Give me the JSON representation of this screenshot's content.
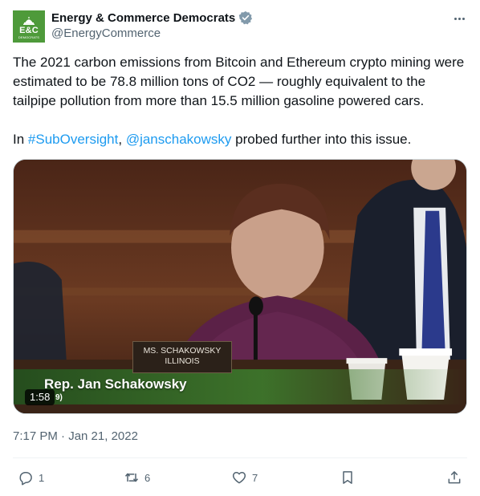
{
  "account": {
    "display_name": "Energy & Commerce Democrats",
    "handle": "@EnergyCommerce",
    "avatar_abbr": "E&C",
    "avatar_sub": "DEMOCRATS",
    "verified_color": "#829aab",
    "avatar_color": "#4e9a3a"
  },
  "post": {
    "line1": "The 2021 carbon emissions from Bitcoin and Ethereum crypto mining were estimated to be 78.8 million tons of CO2 — roughly equivalent to the tailpipe pollution from more than 15.5 million gasoline powered cars.",
    "p2_pre": "In ",
    "hashtag": "#SubOversight",
    "p2_mid": ", ",
    "mention": "@janschakowsky",
    "p2_post": " probed further into this issue.",
    "timestamp": "7:17 PM · Jan 21, 2022"
  },
  "video": {
    "duration": "1:58",
    "caption_name": "Rep. Jan Schakowsky",
    "caption_sub": "9)",
    "nameplate_line1": "MS. SCHAKOWSKY",
    "nameplate_line2": "ILLINOIS"
  },
  "actions": {
    "replies": "1",
    "reposts": "6",
    "likes": "7"
  },
  "colors": {
    "link": "#1d9bf0",
    "secondary_text": "#536471"
  }
}
